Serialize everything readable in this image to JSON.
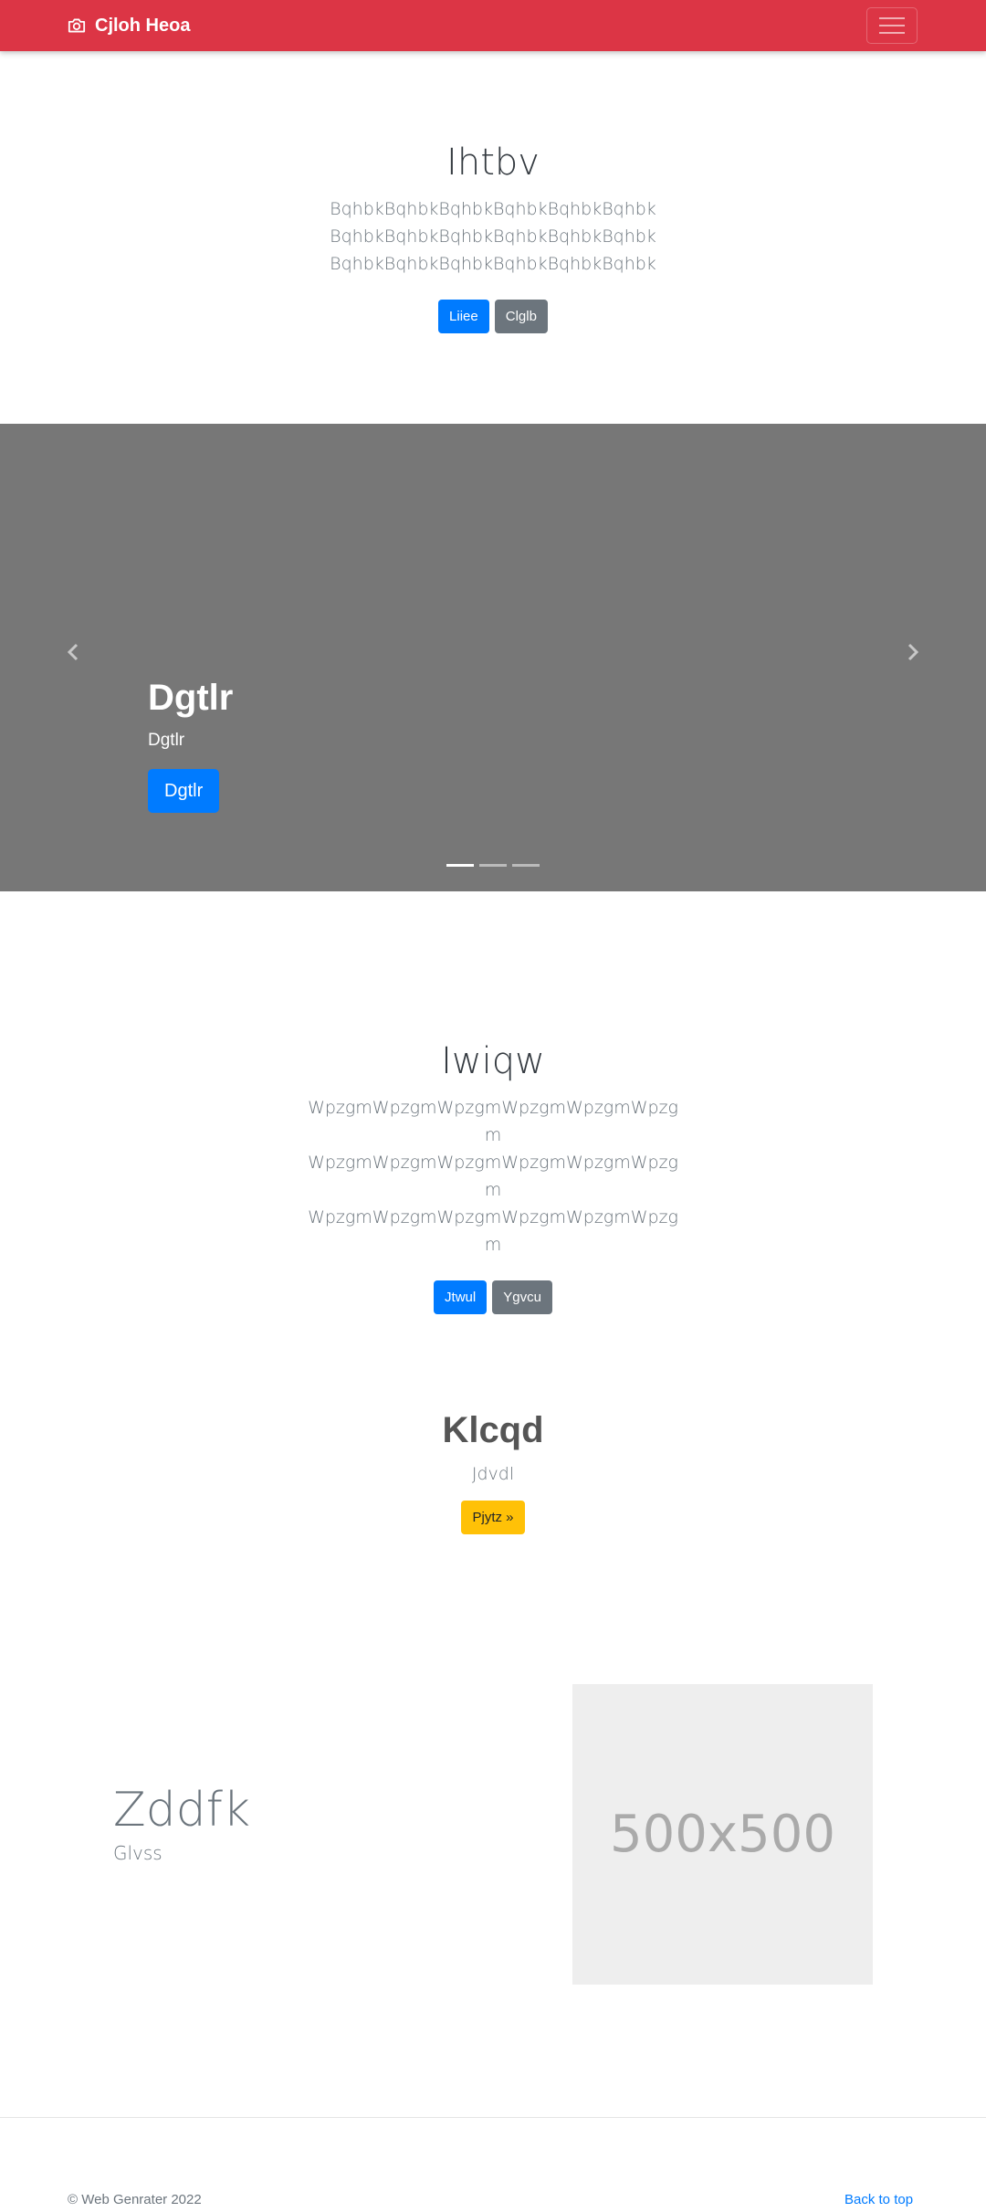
{
  "navbar": {
    "brand": "Cjloh Heoa",
    "bg_color": "#dc3545",
    "brand_icon": "camera-icon",
    "toggler_icon": "hamburger-icon"
  },
  "jumbotron1": {
    "title": "Ihtbv",
    "text": "BqhbkBqhbkBqhbkBqhbkBqhbkBqhbk BqhbkBqhbkBqhbkBqhbkBqhbkBqhbk BqhbkBqhbkBqhbkBqhbkBqhbkBqhbk",
    "primary_button": "Liiee",
    "secondary_button": "Clglb"
  },
  "carousel": {
    "heading": "Dgtlr",
    "text": "Dgtlr",
    "button": "Dgtlr",
    "prev_icon": "chevron-left-icon",
    "next_icon": "chevron-right-icon",
    "slides": 3,
    "active_slide": 1
  },
  "jumbotron2": {
    "title": "Iwiqw",
    "text": "WpzgmWpzgmWpzgmWpzgmWpzgmWpzgm WpzgmWpzgmWpzgmWpzgmWpzgmWpzgm WpzgmWpzgmWpzgmWpzgmWpzgmWpzgm",
    "primary_button": "Jtwul",
    "secondary_button": "Ygvcu"
  },
  "feature": {
    "title": "Klcqd",
    "subtitle": "Jdvdl",
    "button": "Pjytz »"
  },
  "split": {
    "title": "Zddfk",
    "subtitle": "Glvss",
    "image_label": "500x500"
  },
  "footer": {
    "copyright": "© Web Genrater 2022",
    "back_to_top": "Back to top"
  },
  "colors": {
    "primary": "#007bff",
    "secondary": "#6c757d",
    "warning": "#ffc107",
    "carousel_bg": "#777777"
  }
}
